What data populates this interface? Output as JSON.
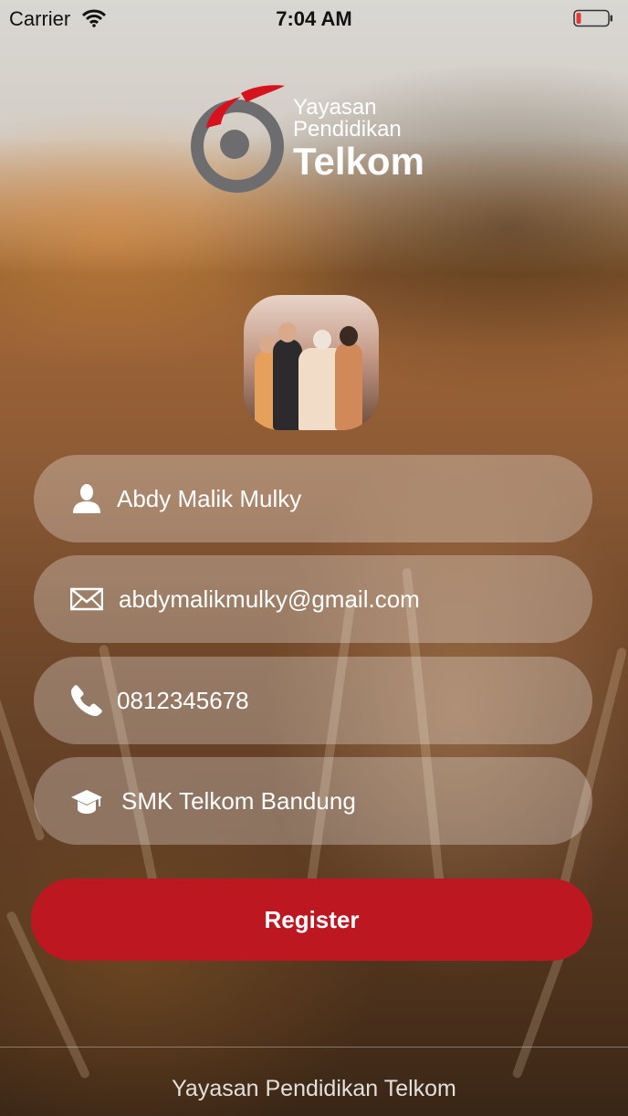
{
  "status_bar": {
    "carrier": "Carrier",
    "time": "7:04 AM",
    "battery_level": 0.15,
    "battery_color": "#e53935"
  },
  "logo": {
    "line1": "Yayasan",
    "line2": "Pendidikan",
    "line3": "Telkom",
    "accent_color": "#d6121f",
    "gray_color": "#6d6d6f"
  },
  "form": {
    "name": {
      "icon": "user-icon",
      "value": "Abdy Malik Mulky"
    },
    "email": {
      "icon": "envelope-icon",
      "value": "abdymalikmulky@gmail.com"
    },
    "phone": {
      "icon": "phone-icon",
      "value": "0812345678"
    },
    "school": {
      "icon": "graduation-cap-icon",
      "value": "SMK Telkom Bandung"
    }
  },
  "register_button": {
    "label": "Register",
    "color": "#bd1722"
  },
  "footer": {
    "text": "Yayasan Pendidikan Telkom"
  }
}
